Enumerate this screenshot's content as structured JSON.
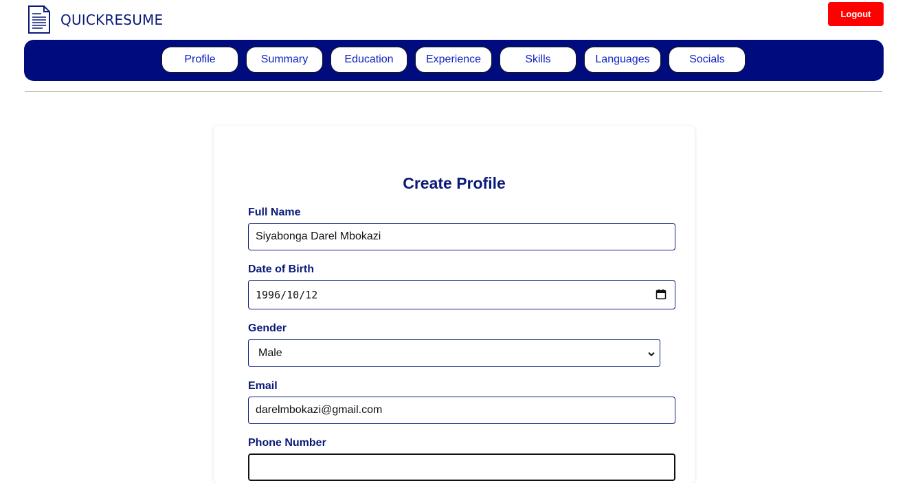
{
  "header": {
    "brand": "QUICKRESUME",
    "logout_label": "Logout"
  },
  "nav": {
    "tabs": [
      "Profile",
      "Summary",
      "Education",
      "Experience",
      "Skills",
      "Languages",
      "Socials"
    ]
  },
  "form": {
    "title": "Create Profile",
    "full_name_label": "Full Name",
    "full_name_value": "Siyabonga Darel Mbokazi",
    "dob_label": "Date of Birth",
    "dob_value": "1996/10/12",
    "gender_label": "Gender",
    "gender_value": "Male",
    "email_label": "Email",
    "email_value": "darelmbokazi@gmail.com",
    "phone_label": "Phone Number",
    "phone_value": ""
  },
  "colors": {
    "navbar": "#000b7e",
    "accent_text": "#0a1a78",
    "logout": "#ff0000"
  }
}
